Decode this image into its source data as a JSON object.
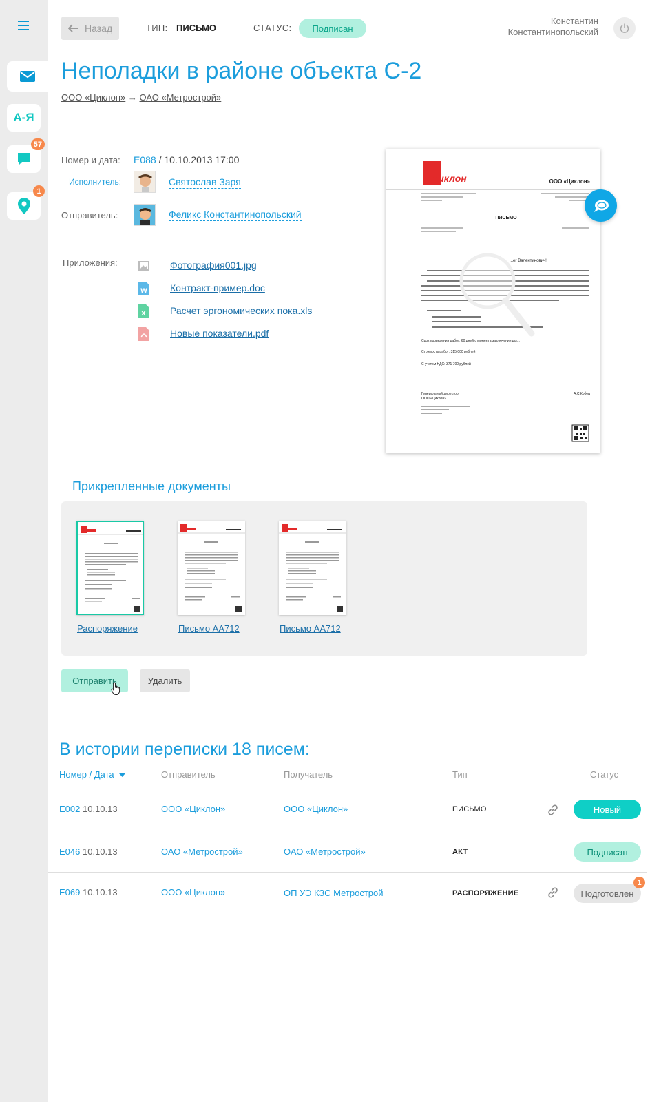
{
  "header": {
    "back_label": "Назад",
    "type_label": "ТИП:",
    "type_value": "ПИСЬМО",
    "status_label": "СТАТУС:",
    "status_value": "Подписан",
    "user_first": "Константин",
    "user_last": "Константинопольский"
  },
  "sidebar": {
    "az_label": "А-Я",
    "chat_badge": "57",
    "location_badge": "1"
  },
  "document": {
    "title": "Неполадки в районе объекта С-2",
    "from_org": "ООО «Циклон»",
    "arrow": "→",
    "to_org": "ОАО «Метрострой»",
    "number_label": "Номер и дата:",
    "number": "E088",
    "date": " / 10.10.2013 17:00",
    "executor_label": "Исполнитель:",
    "executor_name": "Святослав Заря",
    "sender_label": "Отправитель:",
    "sender_name": "Феликс Константинопольский",
    "attachments_label": "Приложения:",
    "attachments": [
      {
        "name": "Фотография001.jpg",
        "icon": "image-file-icon"
      },
      {
        "name": "Контракт-пример.doc",
        "icon": "word-file-icon"
      },
      {
        "name": "Расчет эргономических пока.xls",
        "icon": "excel-file-icon"
      },
      {
        "name": "Новые показатели.pdf",
        "icon": "pdf-file-icon"
      }
    ]
  },
  "preview": {
    "logo": "Циклон",
    "company": "ООО «Циклон»",
    "doc_heading": "ПИСЬМО",
    "greeting": "...ег Валентинович!",
    "terms": "Срок проведения работ: 60 дней с момента заключения дог...",
    "cost": "Стоимость работ: 315 000 рублей",
    "vat": "С учетом НДС: 371 700 рублей",
    "signer_title": "Генеральный директор",
    "signer_org": "ООО «Циклон»",
    "signer_name": "А.С.Кобец"
  },
  "attached_docs": {
    "title": "Прикрепленные документы",
    "items": [
      {
        "label": "Распоряжение",
        "selected": true
      },
      {
        "label": "Письмо АА712",
        "selected": false
      },
      {
        "label": "Письмо АА712",
        "selected": false
      }
    ],
    "send_label": "Отправить",
    "delete_label": "Удалить"
  },
  "history": {
    "title": "В истории переписки 18 писем:",
    "columns": [
      "Номер / Дата",
      "Отправитель",
      "Получатель",
      "Тип",
      "Статус"
    ],
    "rows": [
      {
        "num": "E002",
        "date": " 10.10.13",
        "sender": "ООО «Циклон»",
        "recipient": "ООО «Циклон»",
        "type": "ПИСЬМО",
        "status": "Новый"
      },
      {
        "num": "E046",
        "date": " 10.10.13",
        "sender": "ОАО «Метрострой»",
        "recipient": "ОАО «Метрострой»",
        "type": "АКТ",
        "status": "Подписан"
      },
      {
        "num": "E069",
        "date": " 10.10.13",
        "sender": "ООО «Циклон»",
        "recipient": "ОП УЭ КЗС Метрострой",
        "type": "РАСПОРЯЖЕНИЕ",
        "status": "Подготовлен",
        "badge": "1"
      }
    ]
  },
  "colors": {
    "accent": "#1b9ddc",
    "teal": "#0fcfc6",
    "mint": "#b1f0df",
    "badge": "#f7884b",
    "logo_red": "#e32a2a"
  }
}
